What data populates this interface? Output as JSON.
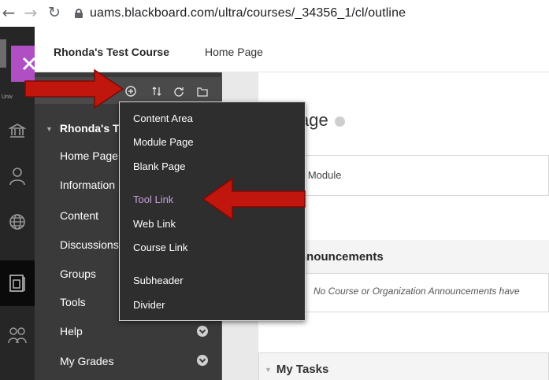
{
  "browser": {
    "back_icon": "←",
    "forward_icon": "→",
    "reload_icon": "↻",
    "url": "uams.blackboard.com/ultra/courses/_34356_1/cl/outline"
  },
  "rail": {
    "logo_text": "Univ"
  },
  "header": {
    "course_title": "Rhonda's Test Course",
    "breadcrumb": "Home Page"
  },
  "course_menu": {
    "root_label": "Rhonda's T",
    "items": [
      {
        "label": "Home Page"
      },
      {
        "label": "Information"
      },
      {
        "label": "Content"
      },
      {
        "label": "Discussions"
      },
      {
        "label": "Groups"
      },
      {
        "label": "Tools"
      },
      {
        "label": "Help"
      },
      {
        "label": "My Grades"
      }
    ]
  },
  "add_menu": {
    "items": [
      {
        "label": "Content Area"
      },
      {
        "label": "Module Page"
      },
      {
        "label": "Blank Page"
      },
      {
        "label": "Tool Link"
      },
      {
        "label": "Web Link"
      },
      {
        "label": "Course Link"
      },
      {
        "label": "Subheader"
      },
      {
        "label": "Divider"
      }
    ],
    "highlight_color": "#c9a0dc"
  },
  "main": {
    "page_title": "age",
    "module_label": "e Module",
    "announcements_title": "nnouncements",
    "announcements_empty": "No Course or Organization Announcements have",
    "tasks_title": "My Tasks"
  },
  "colors": {
    "logo_accent": "#b04fc4",
    "arrow_red": "#c0160e",
    "menu_bg": "#3a3a3a",
    "dropdown_bg": "#2e2e2e"
  }
}
